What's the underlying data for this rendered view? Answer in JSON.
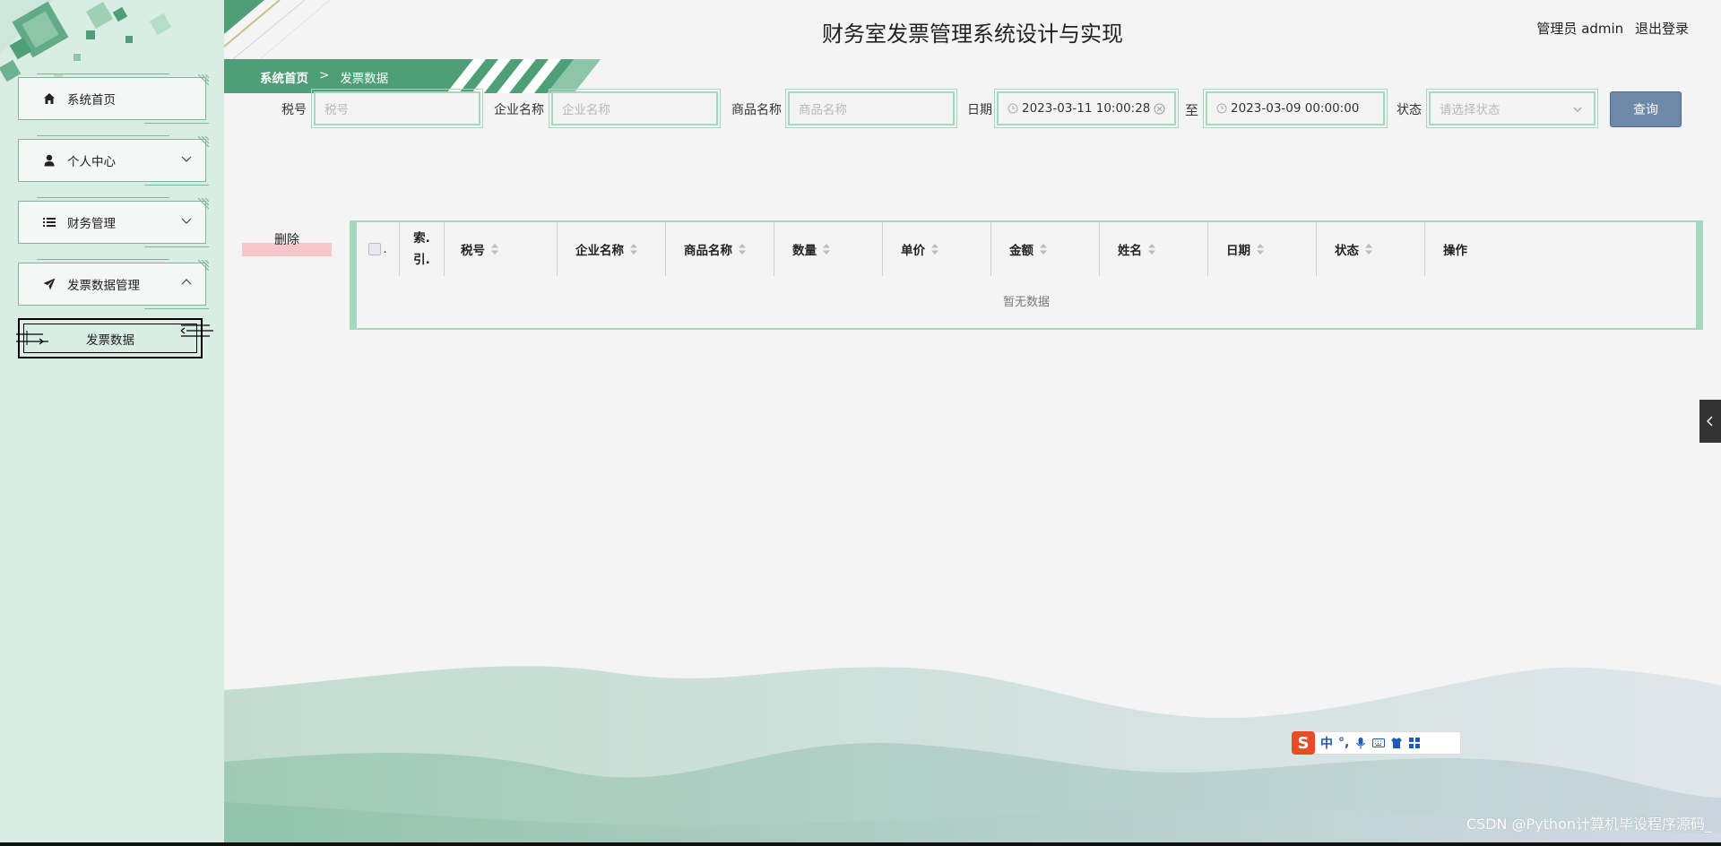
{
  "header": {
    "title": "财务室发票管理系统设计与实现",
    "user_role": "管理员 admin",
    "logout": "退出登录"
  },
  "breadcrumb": {
    "home": "系统首页",
    "separator": ">",
    "current": "发票数据"
  },
  "sidebar": {
    "items": [
      {
        "label": "系统首页",
        "icon": "home-icon"
      },
      {
        "label": "个人中心",
        "icon": "user-icon"
      },
      {
        "label": "财务管理",
        "icon": "list-icon"
      },
      {
        "label": "发票数据管理",
        "icon": "send-icon"
      }
    ],
    "subitem": "发票数据"
  },
  "search": {
    "tax_label": "税号",
    "tax_placeholder": "税号",
    "company_label": "企业名称",
    "company_placeholder": "企业名称",
    "product_label": "商品名称",
    "product_placeholder": "商品名称",
    "date_label": "日期",
    "date_start": "2023-03-11 10:00:28",
    "date_to": "至",
    "date_end": "2023-03-09 00:00:00",
    "status_label": "状态",
    "status_placeholder": "请选择状态",
    "query_button": "查询"
  },
  "actions": {
    "delete": "删除"
  },
  "table": {
    "index_header_line1": "索.",
    "index_header_line2": "引.",
    "columns": [
      "税号",
      "企业名称",
      "商品名称",
      "数量",
      "单价",
      "金额",
      "姓名",
      "日期",
      "状态",
      "操作"
    ],
    "empty_text": "暂无数据"
  },
  "ime": {
    "logo": "S",
    "lang": "中",
    "punct": "°,"
  },
  "watermark": "CSDN @Python计算机毕设程序源码_",
  "colors": {
    "sidebar_bg": "#d9ede4",
    "accent_green": "#4e9e78",
    "border_green": "#a6d7bf",
    "query_btn": "#6e88aa",
    "delete_bar": "#f5c7cb"
  }
}
